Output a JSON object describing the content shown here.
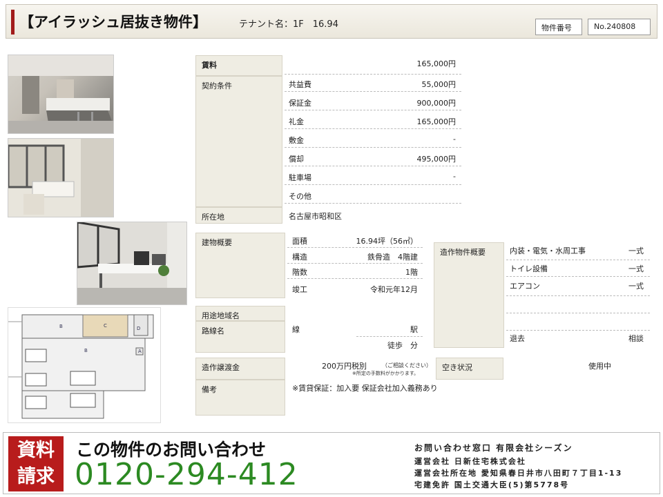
{
  "header": {
    "title": "【アイラッシュ居抜き物件】",
    "tenant": "テナント名：1F　16.94",
    "id_label": "物件番号",
    "id_value": "No.240808"
  },
  "rent": {
    "label": "賃料",
    "value": "165,000円"
  },
  "contract": {
    "label": "契約条件",
    "rows": [
      {
        "k": "共益費",
        "v": "55,000円"
      },
      {
        "k": "保証金",
        "v": "900,000円"
      },
      {
        "k": "礼金",
        "v": "165,000円"
      },
      {
        "k": "敷金",
        "v": "-"
      },
      {
        "k": "償却",
        "v": "495,000円"
      },
      {
        "k": "駐車場",
        "v": "-"
      },
      {
        "k": "その他",
        "v": ""
      }
    ]
  },
  "location": {
    "label": "所在地",
    "value": "名古屋市昭和区"
  },
  "building": {
    "label": "建物概要",
    "rows": [
      {
        "k": "面積",
        "v": "16.94坪（56㎡）"
      },
      {
        "k": "構造",
        "v": "鉄骨造　4階建"
      },
      {
        "k": "階数",
        "v": "1階"
      },
      {
        "k": "竣工",
        "v": "令和元年12月"
      }
    ]
  },
  "zoning": {
    "label": "用途地域名",
    "value": ""
  },
  "route": {
    "label": "路線名",
    "line": "線",
    "station": "駅",
    "walk": "徒歩　分"
  },
  "fixtures": {
    "label": "造作物件概要",
    "rows": [
      {
        "k": "内装・電気・水周工事",
        "v": "一式"
      },
      {
        "k": "トイレ設備",
        "v": "一式"
      },
      {
        "k": "エアコン",
        "v": "一式"
      }
    ],
    "exit_k": "退去",
    "exit_v": "相談"
  },
  "transfer": {
    "label": "造作譲渡金",
    "value": "200万円税別",
    "note1": "（ご相談ください）",
    "note2": "※所定の手数料がかかります。"
  },
  "vacancy": {
    "label": "空き状況",
    "value": "使用中"
  },
  "remarks": {
    "label": "備考",
    "value": "※賃貸保証：加入要 保証会社加入義務あり"
  },
  "floorplan": {
    "labels": [
      "B",
      "C",
      "D",
      "B",
      "A"
    ]
  },
  "footer": {
    "req1": "資料",
    "req2": "請求",
    "contact_head": "この物件のお問い合わせ",
    "phone": "0120-294-412",
    "info1": "お問い合わせ窓口 有限会社シーズン",
    "info2": "運営会社 日新住宅株式会社",
    "info3": "運営会社所在地 愛知県春日井市八田町７丁目1-13",
    "info4": "宅建免許 国土交通大臣(5)第5778号"
  }
}
